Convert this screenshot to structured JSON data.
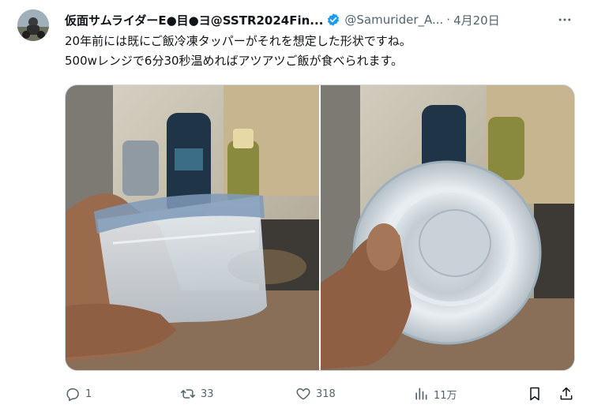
{
  "tweet": {
    "author_name": "仮面サムライダーE●目●ヨ@SSTR2024Fin...",
    "handle": "@Samurider_A...",
    "separator": "·",
    "date": "4月20日",
    "text_lines": [
      "20年前には既にご飯冷凍タッパーがそれを想定した形状ですね。",
      "500wレンジで6分30秒温めればアツアツご飯が食べられます。"
    ]
  },
  "actions": {
    "replies": "1",
    "retweets": "33",
    "likes": "318",
    "views": "11万"
  },
  "icons": {
    "verified": "verified-badge-icon",
    "more": "more-dots-icon",
    "reply": "reply-icon",
    "retweet": "retweet-icon",
    "like": "heart-icon",
    "views": "analytics-icon",
    "bookmark": "bookmark-icon",
    "share": "share-icon"
  },
  "colors": {
    "verified": "#1d9bf0",
    "text_secondary": "#536471",
    "text_primary": "#0f1419"
  }
}
